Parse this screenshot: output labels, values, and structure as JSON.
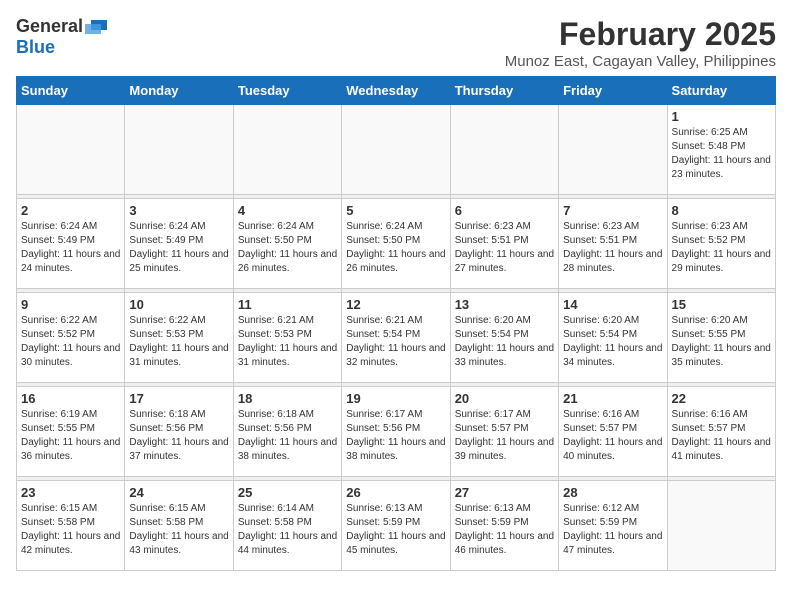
{
  "header": {
    "logo_general": "General",
    "logo_blue": "Blue",
    "month_year": "February 2025",
    "location": "Munoz East, Cagayan Valley, Philippines"
  },
  "weekdays": [
    "Sunday",
    "Monday",
    "Tuesday",
    "Wednesday",
    "Thursday",
    "Friday",
    "Saturday"
  ],
  "weeks": [
    [
      {
        "day": "",
        "info": ""
      },
      {
        "day": "",
        "info": ""
      },
      {
        "day": "",
        "info": ""
      },
      {
        "day": "",
        "info": ""
      },
      {
        "day": "",
        "info": ""
      },
      {
        "day": "",
        "info": ""
      },
      {
        "day": "1",
        "info": "Sunrise: 6:25 AM\nSunset: 5:48 PM\nDaylight: 11 hours and 23 minutes."
      }
    ],
    [
      {
        "day": "2",
        "info": "Sunrise: 6:24 AM\nSunset: 5:49 PM\nDaylight: 11 hours and 24 minutes."
      },
      {
        "day": "3",
        "info": "Sunrise: 6:24 AM\nSunset: 5:49 PM\nDaylight: 11 hours and 25 minutes."
      },
      {
        "day": "4",
        "info": "Sunrise: 6:24 AM\nSunset: 5:50 PM\nDaylight: 11 hours and 26 minutes."
      },
      {
        "day": "5",
        "info": "Sunrise: 6:24 AM\nSunset: 5:50 PM\nDaylight: 11 hours and 26 minutes."
      },
      {
        "day": "6",
        "info": "Sunrise: 6:23 AM\nSunset: 5:51 PM\nDaylight: 11 hours and 27 minutes."
      },
      {
        "day": "7",
        "info": "Sunrise: 6:23 AM\nSunset: 5:51 PM\nDaylight: 11 hours and 28 minutes."
      },
      {
        "day": "8",
        "info": "Sunrise: 6:23 AM\nSunset: 5:52 PM\nDaylight: 11 hours and 29 minutes."
      }
    ],
    [
      {
        "day": "9",
        "info": "Sunrise: 6:22 AM\nSunset: 5:52 PM\nDaylight: 11 hours and 30 minutes."
      },
      {
        "day": "10",
        "info": "Sunrise: 6:22 AM\nSunset: 5:53 PM\nDaylight: 11 hours and 31 minutes."
      },
      {
        "day": "11",
        "info": "Sunrise: 6:21 AM\nSunset: 5:53 PM\nDaylight: 11 hours and 31 minutes."
      },
      {
        "day": "12",
        "info": "Sunrise: 6:21 AM\nSunset: 5:54 PM\nDaylight: 11 hours and 32 minutes."
      },
      {
        "day": "13",
        "info": "Sunrise: 6:20 AM\nSunset: 5:54 PM\nDaylight: 11 hours and 33 minutes."
      },
      {
        "day": "14",
        "info": "Sunrise: 6:20 AM\nSunset: 5:54 PM\nDaylight: 11 hours and 34 minutes."
      },
      {
        "day": "15",
        "info": "Sunrise: 6:20 AM\nSunset: 5:55 PM\nDaylight: 11 hours and 35 minutes."
      }
    ],
    [
      {
        "day": "16",
        "info": "Sunrise: 6:19 AM\nSunset: 5:55 PM\nDaylight: 11 hours and 36 minutes."
      },
      {
        "day": "17",
        "info": "Sunrise: 6:18 AM\nSunset: 5:56 PM\nDaylight: 11 hours and 37 minutes."
      },
      {
        "day": "18",
        "info": "Sunrise: 6:18 AM\nSunset: 5:56 PM\nDaylight: 11 hours and 38 minutes."
      },
      {
        "day": "19",
        "info": "Sunrise: 6:17 AM\nSunset: 5:56 PM\nDaylight: 11 hours and 38 minutes."
      },
      {
        "day": "20",
        "info": "Sunrise: 6:17 AM\nSunset: 5:57 PM\nDaylight: 11 hours and 39 minutes."
      },
      {
        "day": "21",
        "info": "Sunrise: 6:16 AM\nSunset: 5:57 PM\nDaylight: 11 hours and 40 minutes."
      },
      {
        "day": "22",
        "info": "Sunrise: 6:16 AM\nSunset: 5:57 PM\nDaylight: 11 hours and 41 minutes."
      }
    ],
    [
      {
        "day": "23",
        "info": "Sunrise: 6:15 AM\nSunset: 5:58 PM\nDaylight: 11 hours and 42 minutes."
      },
      {
        "day": "24",
        "info": "Sunrise: 6:15 AM\nSunset: 5:58 PM\nDaylight: 11 hours and 43 minutes."
      },
      {
        "day": "25",
        "info": "Sunrise: 6:14 AM\nSunset: 5:58 PM\nDaylight: 11 hours and 44 minutes."
      },
      {
        "day": "26",
        "info": "Sunrise: 6:13 AM\nSunset: 5:59 PM\nDaylight: 11 hours and 45 minutes."
      },
      {
        "day": "27",
        "info": "Sunrise: 6:13 AM\nSunset: 5:59 PM\nDaylight: 11 hours and 46 minutes."
      },
      {
        "day": "28",
        "info": "Sunrise: 6:12 AM\nSunset: 5:59 PM\nDaylight: 11 hours and 47 minutes."
      },
      {
        "day": "",
        "info": ""
      }
    ]
  ]
}
